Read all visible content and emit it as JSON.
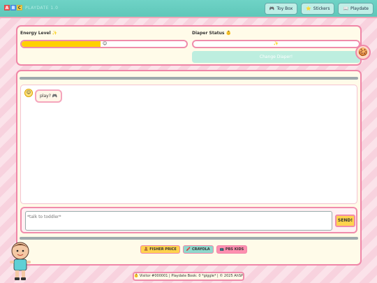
{
  "header": {
    "logo_blocks": [
      "A",
      "B",
      "C"
    ],
    "logo_colors": [
      "#ff5a5a",
      "#5aa0ff",
      "#ffd84d"
    ],
    "logo_text": "PLAYDATE 1.0",
    "nav": [
      {
        "label": "Toy Box",
        "icon": "gamepad-icon",
        "glyph": "🎮"
      },
      {
        "label": "Stickers",
        "icon": "star-icon",
        "glyph": "⭐"
      },
      {
        "label": "Playdate",
        "icon": "book-icon",
        "glyph": "📖"
      }
    ]
  },
  "status": {
    "energy_label": "Energy Level ✨",
    "energy_fraction": 0.48,
    "energy_emoji": "😊",
    "diaper_label": "Diaper Status 👶",
    "diaper_value": "✨",
    "change_button": "Change Diaper!",
    "cookie": "🍪"
  },
  "chat": {
    "messages": [
      {
        "avatar": "😊",
        "text": "play? 🎮"
      }
    ],
    "input_placeholder": "*talk to toddler*",
    "send_label": "SEND!"
  },
  "sponsors": [
    {
      "label": "FISHER PRICE",
      "glyph": "🧸",
      "color": "#ffd34d"
    },
    {
      "label": "CRAYOLA",
      "glyph": "🖍️",
      "color": "#8fd8cc"
    },
    {
      "label": "PBS KIDS",
      "glyph": "📺",
      "color": "#ff8fb0"
    }
  ],
  "footer": {
    "text": "👶 Visitor #000001 | Playdate Book: 0 *giggle* | © 2025 AhSPT"
  }
}
